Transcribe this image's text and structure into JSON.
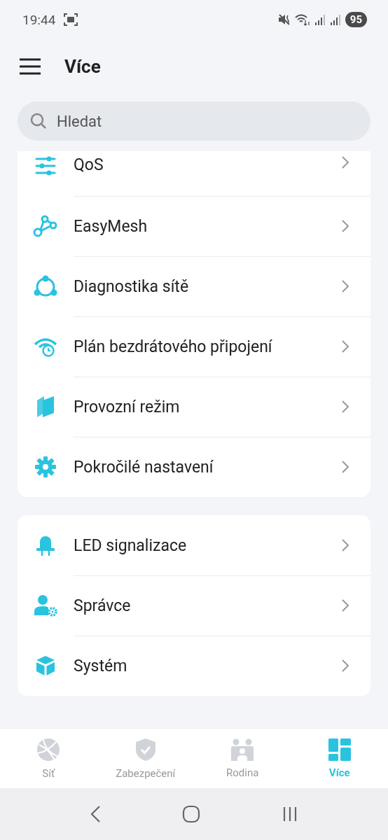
{
  "status_bar": {
    "time": "19:44",
    "battery": "95"
  },
  "header": {
    "title": "Více"
  },
  "search": {
    "placeholder": "Hledat"
  },
  "groups": [
    {
      "cut_top": true,
      "items": [
        {
          "label": "QoS"
        },
        {
          "label": "EasyMesh"
        },
        {
          "label": "Diagnostika sítě"
        },
        {
          "label": "Plán bezdrátového připojení"
        },
        {
          "label": "Provozní režim"
        },
        {
          "label": "Pokročilé nastavení"
        }
      ]
    },
    {
      "cut_top": false,
      "items": [
        {
          "label": "LED signalizace"
        },
        {
          "label": "Správce"
        },
        {
          "label": "Systém"
        }
      ]
    }
  ],
  "bottom_nav": [
    {
      "label": "Síť",
      "selected": false
    },
    {
      "label": "Zabezpečení",
      "selected": false
    },
    {
      "label": "Rodina",
      "selected": false
    },
    {
      "label": "Více",
      "selected": true
    }
  ]
}
